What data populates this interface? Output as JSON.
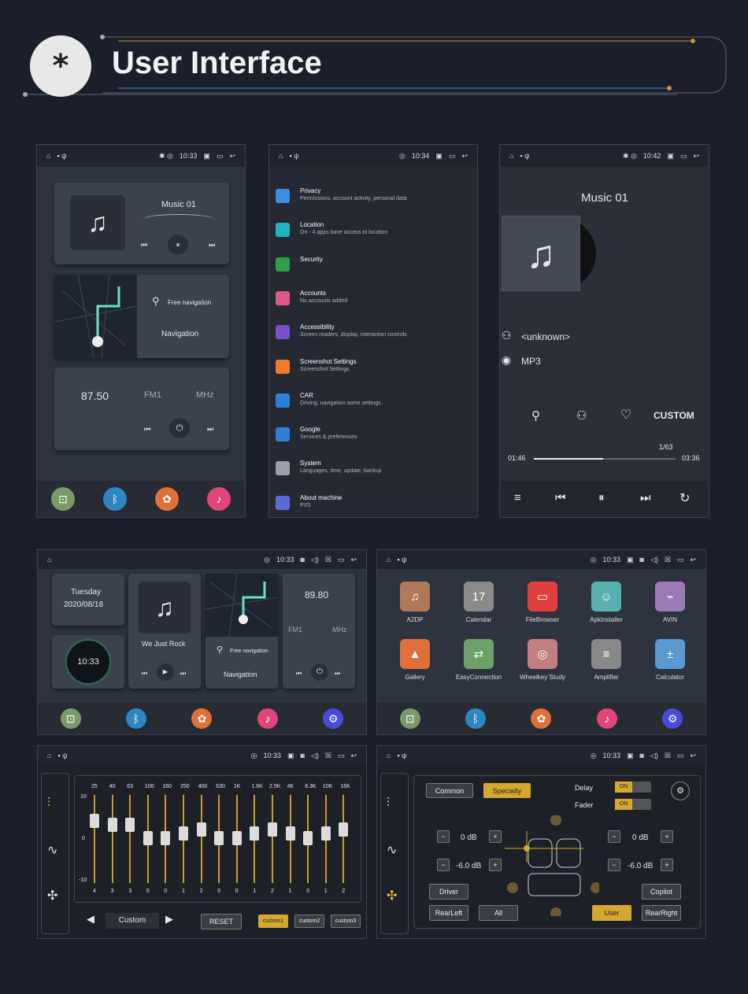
{
  "header": {
    "logo_symbol": "*",
    "title": "User Interface"
  },
  "s1": {
    "time": "10:33",
    "music_title": "Music 01",
    "nav_label1": "Free navigation",
    "nav_label2": "Navigation",
    "radio_freq": "87.50",
    "radio_band": "FM1",
    "radio_unit": "MHz"
  },
  "s2": {
    "time": "10:34",
    "items": [
      {
        "title": "Privacy",
        "sub": "Permissions, account activity, personal data",
        "color": "#3a8ee6"
      },
      {
        "title": "Location",
        "sub": "On - 4 apps have access to location",
        "color": "#20b3c2"
      },
      {
        "title": "Security",
        "sub": "",
        "color": "#2f9e44"
      },
      {
        "title": "Accounts",
        "sub": "No accounts added",
        "color": "#e0588a"
      },
      {
        "title": "Accessibility",
        "sub": "Screen readers, display, interaction controls",
        "color": "#7a4fc7"
      },
      {
        "title": "Screenshot Settings",
        "sub": "Screenshot Settings",
        "color": "#ef7b2d"
      },
      {
        "title": "CAR",
        "sub": "Driving, navigation some settings",
        "color": "#2e7fd8"
      },
      {
        "title": "Google",
        "sub": "Services & preferences",
        "color": "#2e7fd8"
      },
      {
        "title": "System",
        "sub": "Languages, time, update, backup",
        "color": "#9aa0a6"
      },
      {
        "title": "About machine",
        "sub": "PX5",
        "color": "#5b6bd6"
      }
    ]
  },
  "s3": {
    "time": "10:42",
    "title": "Music 01",
    "artist": "<unknown>",
    "format": "MP3",
    "custom": "CUSTOM",
    "track": "1/63",
    "elapsed": "01:46",
    "total": "03:36",
    "progress": 0.49
  },
  "s4": {
    "time": "10:33",
    "day": "Tuesday",
    "date": "2020/08/18",
    "clock": "10:33",
    "song": "We Just Rock",
    "nav_label1": "Free navigation",
    "nav_label2": "Navigation",
    "radio_freq": "89.80",
    "radio_band": "FM1",
    "radio_unit": "MHz"
  },
  "s5": {
    "time": "10:33",
    "apps": [
      {
        "name": "A2DP",
        "color": "#b07a5a",
        "icon": "♫"
      },
      {
        "name": "Calendar",
        "color": "#8a8a8a",
        "icon": "17"
      },
      {
        "name": "FileBrowser",
        "color": "#e04040",
        "icon": "▭"
      },
      {
        "name": "ApkInstaller",
        "color": "#5ab0b0",
        "icon": "☺"
      },
      {
        "name": "AVIN",
        "color": "#9c7ab5",
        "icon": "⌁"
      },
      {
        "name": "Gallery",
        "color": "#e0703a",
        "icon": "▲"
      },
      {
        "name": "EasyConnection",
        "color": "#6fa06a",
        "icon": "⇄"
      },
      {
        "name": "Wheelkey Study",
        "color": "#c08080",
        "icon": "◎"
      },
      {
        "name": "Amplifier",
        "color": "#888888",
        "icon": "≡"
      },
      {
        "name": "Calculator",
        "color": "#5a9ad0",
        "icon": "±"
      }
    ]
  },
  "s6": {
    "time": "10:33",
    "freqs": [
      "25",
      "40",
      "63",
      "100",
      "160",
      "250",
      "400",
      "630",
      "1K",
      "1.6K",
      "2.5K",
      "4K",
      "6.3K",
      "10K",
      "16K"
    ],
    "values": [
      4,
      3,
      3,
      0,
      0,
      1,
      2,
      0,
      0,
      1,
      2,
      1,
      0,
      1,
      2
    ],
    "y_top": "10",
    "y_mid": "0",
    "y_bot": "-10",
    "preset": "Custom",
    "reset": "RESET",
    "presets": [
      "custom1",
      "custom2",
      "custom3"
    ]
  },
  "s7": {
    "time": "10:33",
    "common": "Common",
    "specialty": "Specialty",
    "delay": "Delay",
    "fader": "Fader",
    "toggle_on": "ON",
    "db1": "0 dB",
    "db2": "0 dB",
    "db3": "-6.0 dB",
    "db4": "-6.0 dB",
    "driver": "Driver",
    "copilot": "Copilot",
    "rearleft": "RearLeft",
    "all": "All",
    "user": "User",
    "rearright": "RearRight"
  }
}
